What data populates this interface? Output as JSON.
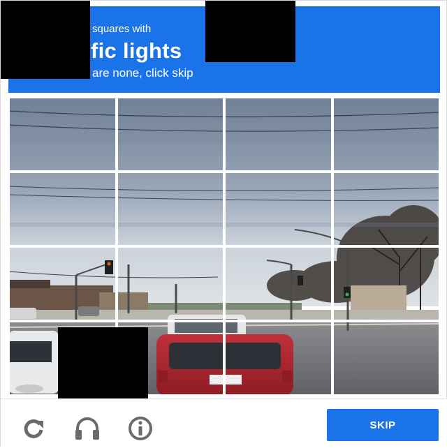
{
  "header": {
    "line1": "squares with",
    "line2": "fic lights",
    "line3": "are none, click skip",
    "background_color": "#1a73e8"
  },
  "grid": {
    "rows": 4,
    "columns": 4,
    "image_description_icon": "street-scene-image"
  },
  "footer": {
    "reload_icon": "reload-icon",
    "audio_icon": "headphones-icon",
    "info_icon": "info-icon",
    "skip_label": "SKIP",
    "skip_color": "#1a73e8"
  }
}
